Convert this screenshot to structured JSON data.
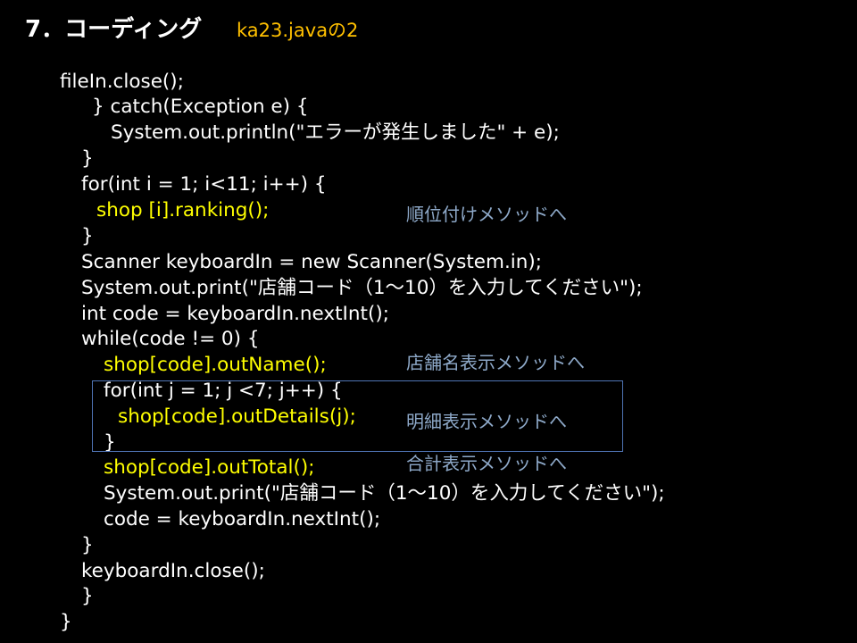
{
  "slide": {
    "title": "7．コーディング",
    "subtitle": "ka23.javaの2"
  },
  "code_lines": [
    "fileIn.close();",
    "} catch(Exception e) {",
    "System.out.println(\"エラーが発生しました\" + e);",
    "}",
    "for(int i = 1; i<11; i++) {",
    "shop [i].ranking();",
    "}",
    "Scanner keyboardIn = new Scanner(System.in);",
    "System.out.print(\"店舗コード（1～10）を入力してください\");",
    "int code = keyboardIn.nextInt();",
    "while(code != 0) {",
    "shop[code].outName();",
    "for(int j = 1; j <7; j++) {",
    "shop[code].outDetails(j);",
    "}",
    "shop[code].outTotal();",
    "System.out.print(\"店舗コード（1～10）を入力してください\");",
    "code = keyboardIn.nextInt();",
    "}",
    "keyboardIn.close();",
    "}",
    "}"
  ],
  "annotations": {
    "ranking": "順位付けメソッドへ",
    "name": "店舗名表示メソッドへ",
    "details": "明細表示メソッドへ",
    "total": "合計表示メソッドへ"
  },
  "colors": {
    "background": "#000000",
    "code": "#ffffff",
    "method_call": "#ffff00",
    "subtitle": "#ffc000",
    "annotation": "#8ea9c9",
    "box_border": "#4f74b4"
  }
}
